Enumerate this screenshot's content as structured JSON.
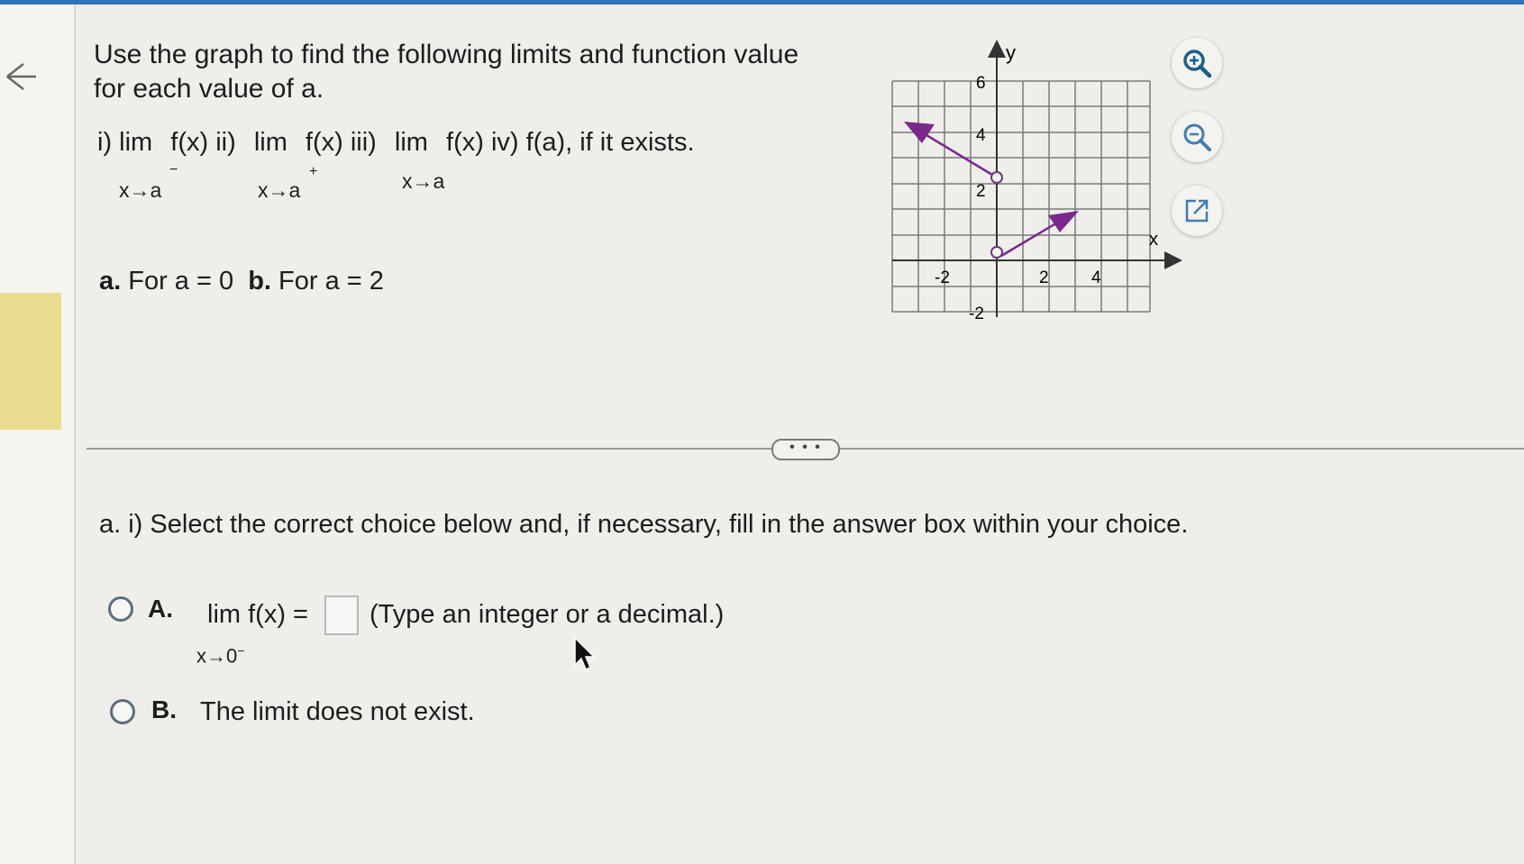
{
  "question": {
    "line1": "Use the graph to find the following limits and function value",
    "line2": "for each value of a.",
    "items_i": "i) lim",
    "fx1": "f(x) ii)",
    "lim2": "lim",
    "fx2": "f(x) iii)",
    "lim3": "lim",
    "fx3": "f(x) iv) f(a), if it exists.",
    "sub1": "x→a",
    "sup1": "−",
    "sub2": "x→a",
    "sup2": "+",
    "sub3": "x→a",
    "parts_a": "a.",
    "parts_a_text": "For a = 0",
    "parts_b": "b.",
    "parts_b_text": "For a = 2"
  },
  "graph": {
    "x_label": "x",
    "y_label": "y",
    "y_ticks": [
      "6",
      "4",
      "2",
      "-2"
    ],
    "x_ticks": [
      "-2",
      "2",
      "4"
    ],
    "line_color": "#7b2a8c"
  },
  "tools": {
    "zoom_in": "zoom-in-icon",
    "zoom_out": "zoom-out-icon",
    "open_new": "external-link-icon"
  },
  "divider": {
    "label": "• • •"
  },
  "answer": {
    "instruction": "a. i) Select the correct choice below and, if necessary, fill in the answer box within your choice.",
    "optA_letter": "A.",
    "optA_lim": "lim  f(x) =",
    "optA_sub": "x→0",
    "optA_sup": "−",
    "optA_hint": "(Type an integer or a decimal.)",
    "optA_value": "",
    "optB_letter": "B.",
    "optB_text": "The limit does not exist."
  }
}
